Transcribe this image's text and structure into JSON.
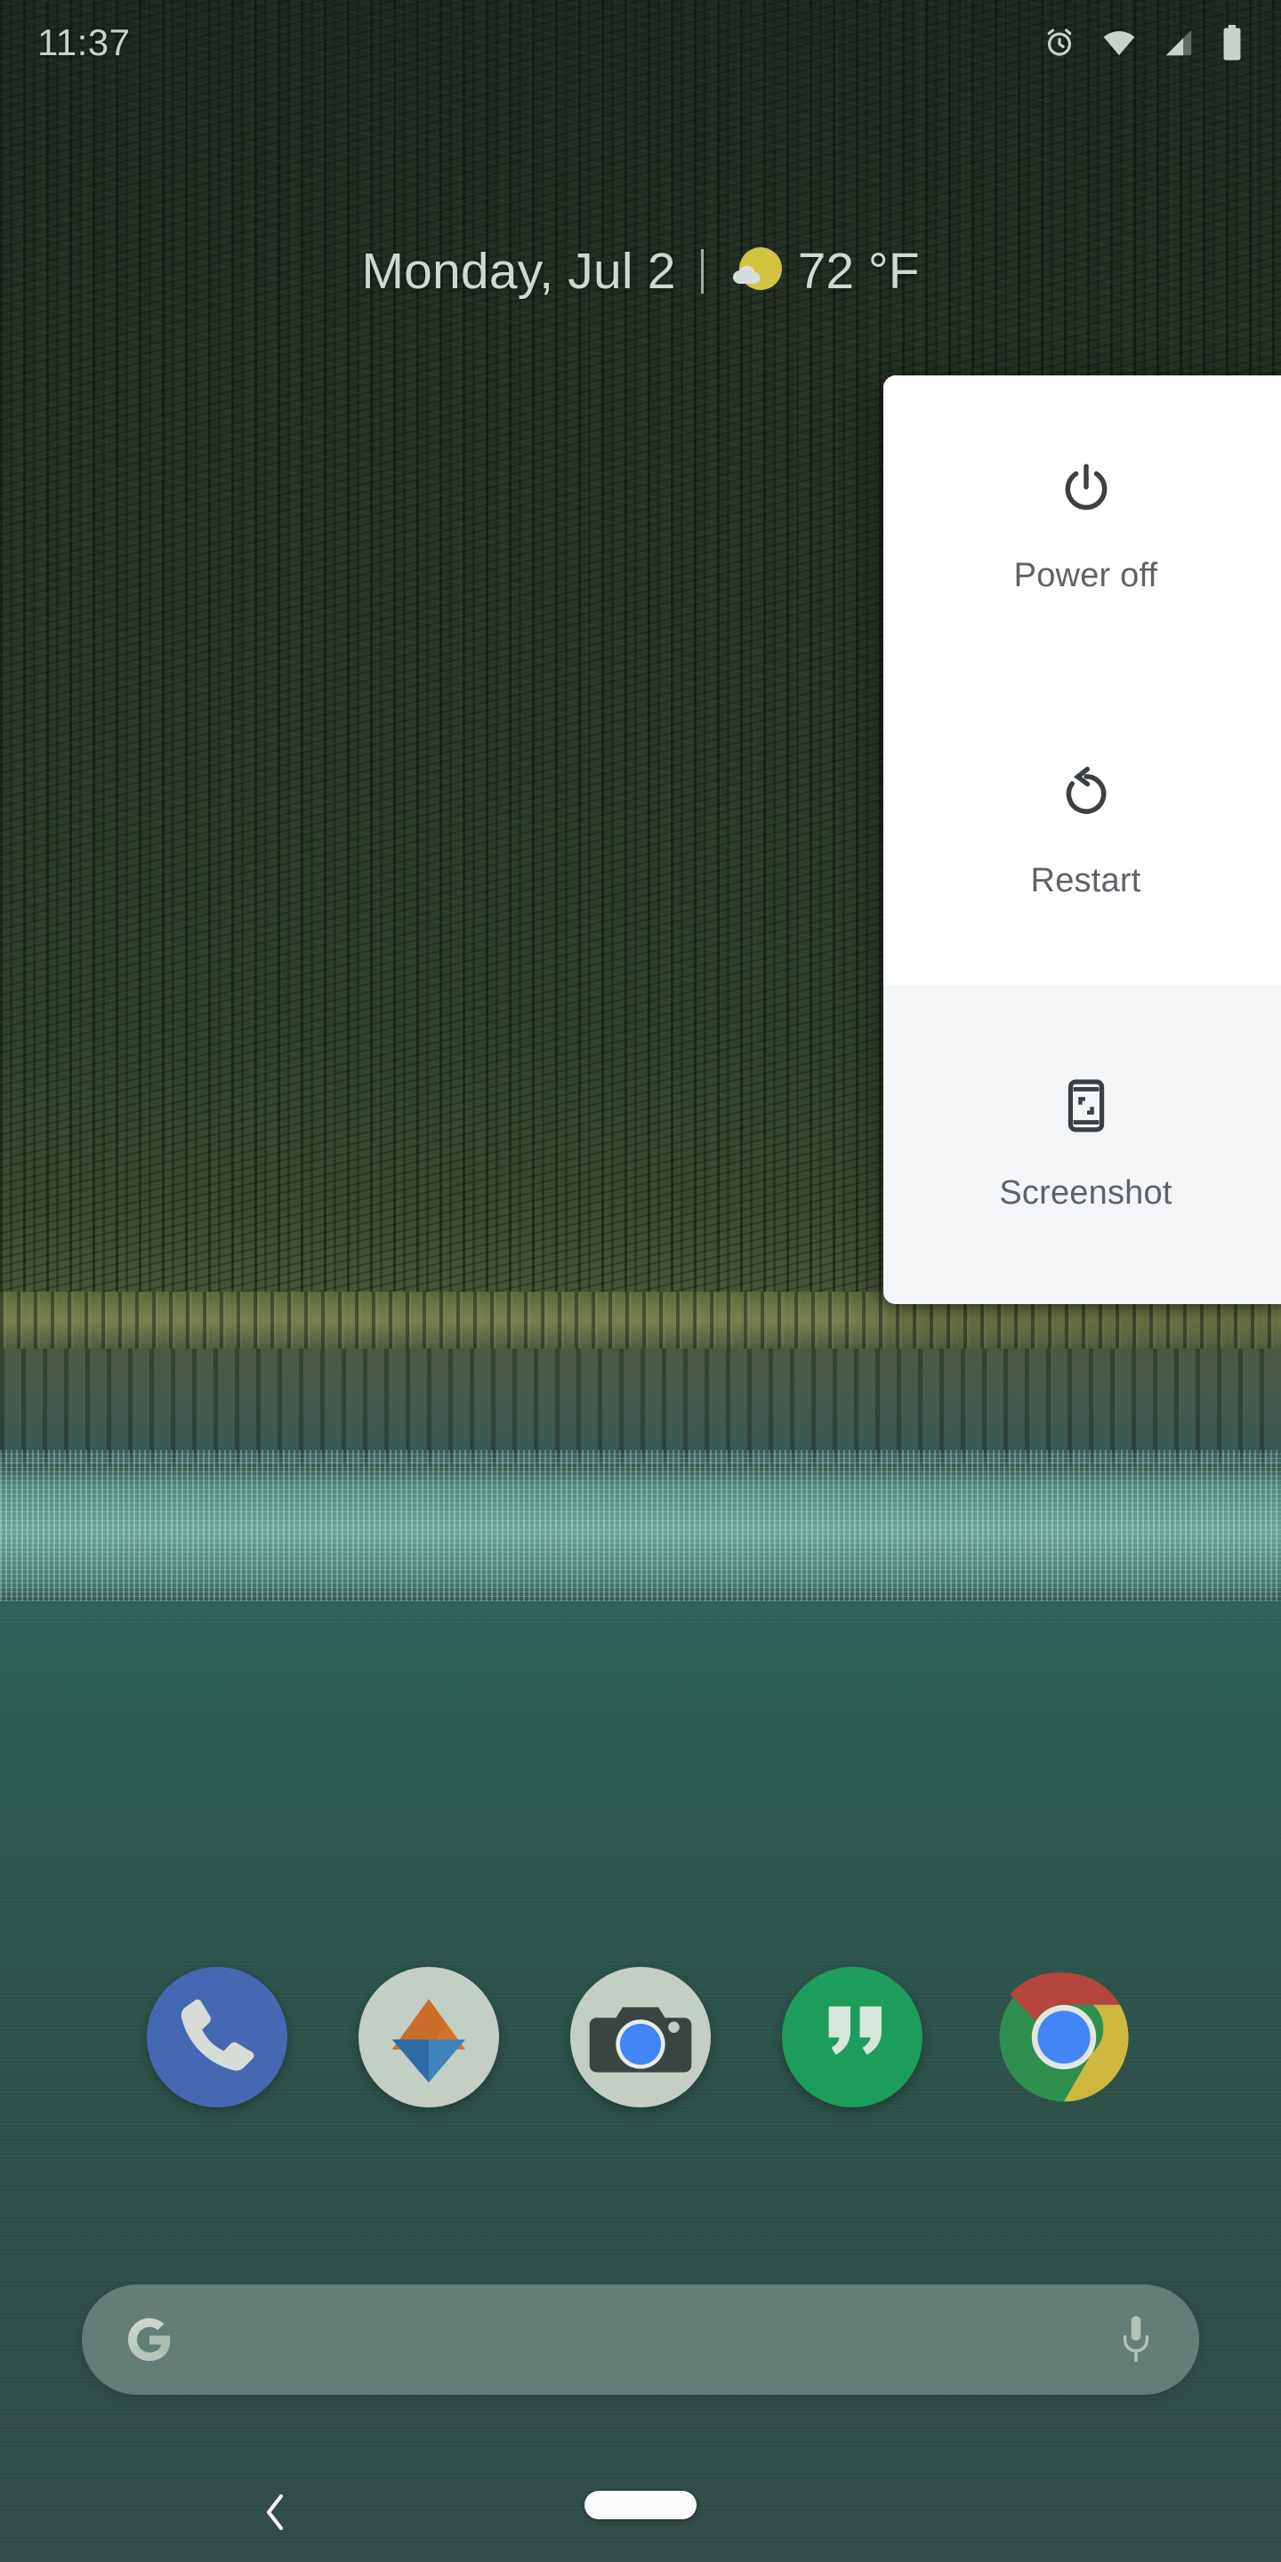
{
  "status_bar": {
    "time": "11:37",
    "icons": [
      {
        "name": "alarm-icon",
        "label": "Alarm set"
      },
      {
        "name": "wifi-icon",
        "label": "Wi-Fi full signal"
      },
      {
        "name": "cell-signal-icon",
        "label": "Mobile signal"
      },
      {
        "name": "battery-icon",
        "label": "Battery"
      }
    ]
  },
  "date_widget": {
    "date": "Monday, Jul 2",
    "separator": "|",
    "temperature": "72 °F",
    "weather_icon": "partly-cloudy-icon",
    "sun_color": "#d4c33f",
    "cloud_color": "#d8dedb",
    "text_color": "#cfd9d1"
  },
  "power_menu": {
    "panel_background": "#ffffff",
    "highlight_background": "#f5f6f7",
    "label_color": "#5f6368",
    "icon_color": "#3c4043",
    "items": [
      {
        "id": "power-off",
        "label": "Power off",
        "icon": "power-icon"
      },
      {
        "id": "restart",
        "label": "Restart",
        "icon": "restart-icon"
      },
      {
        "id": "screenshot",
        "label": "Screenshot",
        "icon": "screenshot-icon"
      }
    ]
  },
  "dock": {
    "apps": [
      {
        "id": "phone",
        "name": "Phone",
        "icon": "phone-icon",
        "color": "#4668b3"
      },
      {
        "id": "drive",
        "name": "Drive",
        "icon": "drive-icon",
        "color": "#c3cec4"
      },
      {
        "id": "camera",
        "name": "Camera",
        "icon": "camera-icon",
        "color": "#c3cec4"
      },
      {
        "id": "hangouts",
        "name": "Hangouts",
        "icon": "hangouts-icon",
        "color": "#1d9d5c"
      },
      {
        "id": "chrome",
        "name": "Chrome",
        "icon": "chrome-icon",
        "color": "#4285f4"
      }
    ]
  },
  "search_bar": {
    "logo": "google-g-icon",
    "value": "",
    "placeholder": "",
    "mic_icon": "microphone-icon",
    "background": "rgba(196,214,206,0.35)"
  },
  "nav_bar": {
    "back": {
      "name": "back-icon",
      "label": "Back"
    },
    "home": {
      "name": "home-pill",
      "label": "Home"
    }
  },
  "wallpaper": {
    "description": "Forest and turquoise lake",
    "forest_color": "#263126",
    "shore_color": "#7d8450",
    "lake_color": "#2c554c",
    "shimmer_color": "#6aaa9a"
  }
}
